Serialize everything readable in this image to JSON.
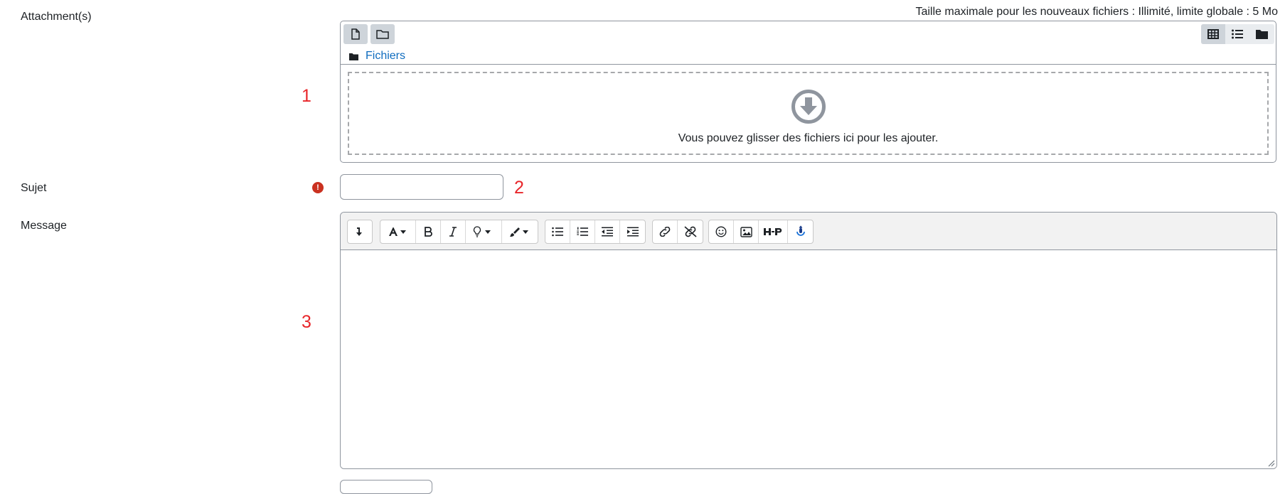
{
  "attachments": {
    "label": "Attachment(s)",
    "max_size_text": "Taille maximale pour les nouveaux fichiers : Illimité, limite globale : 5 Mo",
    "path_label": "Fichiers",
    "drop_text": "Vous pouvez glisser des fichiers ici pour les ajouter."
  },
  "subject": {
    "label": "Sujet",
    "value": "",
    "placeholder": ""
  },
  "message": {
    "label": "Message",
    "value": ""
  },
  "markers": {
    "one": "1",
    "two": "2",
    "three": "3"
  },
  "colors": {
    "marker": "#e8262a",
    "link": "#0f6cbf",
    "required": "#ca3120",
    "h5p_accent": "#1a73d9"
  },
  "icons": {
    "filepicker": [
      "file-icon",
      "folder-icon"
    ],
    "view_modes": [
      "grid-view-icon",
      "list-view-icon",
      "tree-view-icon"
    ],
    "editor_toolbar": [
      "collapse-icon",
      "font-style-icon",
      "bold-icon",
      "italic-icon",
      "lightbulb-icon",
      "paintbrush-icon",
      "unordered-list-icon",
      "ordered-list-icon",
      "outdent-icon",
      "indent-icon",
      "link-icon",
      "unlink-icon",
      "emoji-icon",
      "image-icon",
      "h5p-icon",
      "record-icon"
    ]
  }
}
